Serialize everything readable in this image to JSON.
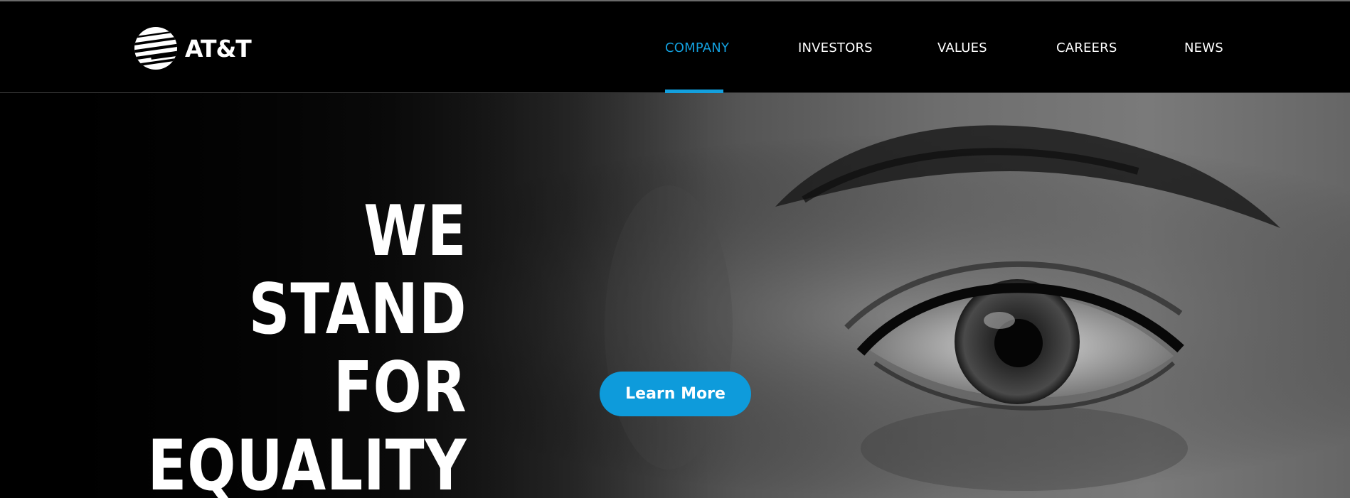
{
  "header": {
    "logo_text": "AT&T",
    "nav": [
      {
        "label": "COMPANY",
        "active": true
      },
      {
        "label": "INVESTORS",
        "active": false
      },
      {
        "label": "VALUES",
        "active": false
      },
      {
        "label": "CAREERS",
        "active": false
      },
      {
        "label": "NEWS",
        "active": false
      }
    ]
  },
  "hero": {
    "headline_lines": [
      "WE",
      "STAND",
      "FOR",
      "EQUALITY"
    ],
    "cta_label": "Learn More",
    "image_subject": "close-up grayscale photo of a person's eye"
  },
  "colors": {
    "accent": "#13a0de",
    "button": "#0e9bdb",
    "background": "#000000",
    "text": "#ffffff"
  }
}
